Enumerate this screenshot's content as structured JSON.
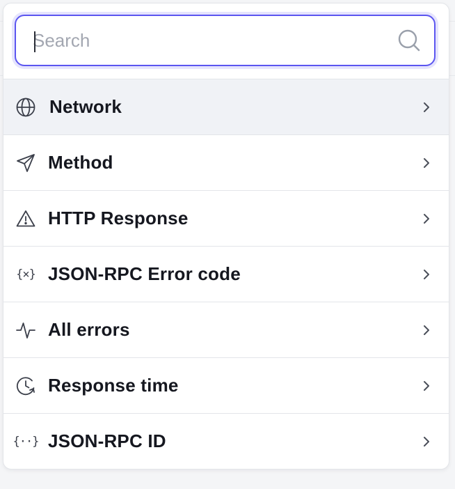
{
  "search": {
    "placeholder": "Search",
    "value": "",
    "icon": "search-icon"
  },
  "menu": {
    "items": [
      {
        "label": "Network",
        "icon": "globe-icon",
        "active": true
      },
      {
        "label": "Method",
        "icon": "send-icon",
        "active": false
      },
      {
        "label": "HTTP Response",
        "icon": "warning-triangle-icon",
        "active": false
      },
      {
        "label": "JSON-RPC Error code",
        "icon": "variable-icon",
        "active": false
      },
      {
        "label": "All errors",
        "icon": "activity-icon",
        "active": false
      },
      {
        "label": "Response time",
        "icon": "clock-icon",
        "active": false
      },
      {
        "label": "JSON-RPC ID",
        "icon": "braces-dots-icon",
        "active": false
      }
    ]
  },
  "colors": {
    "accent": "#5b55f0",
    "active_row": "#f0f2f6",
    "border": "#e3e5e9",
    "text": "#15171f"
  }
}
